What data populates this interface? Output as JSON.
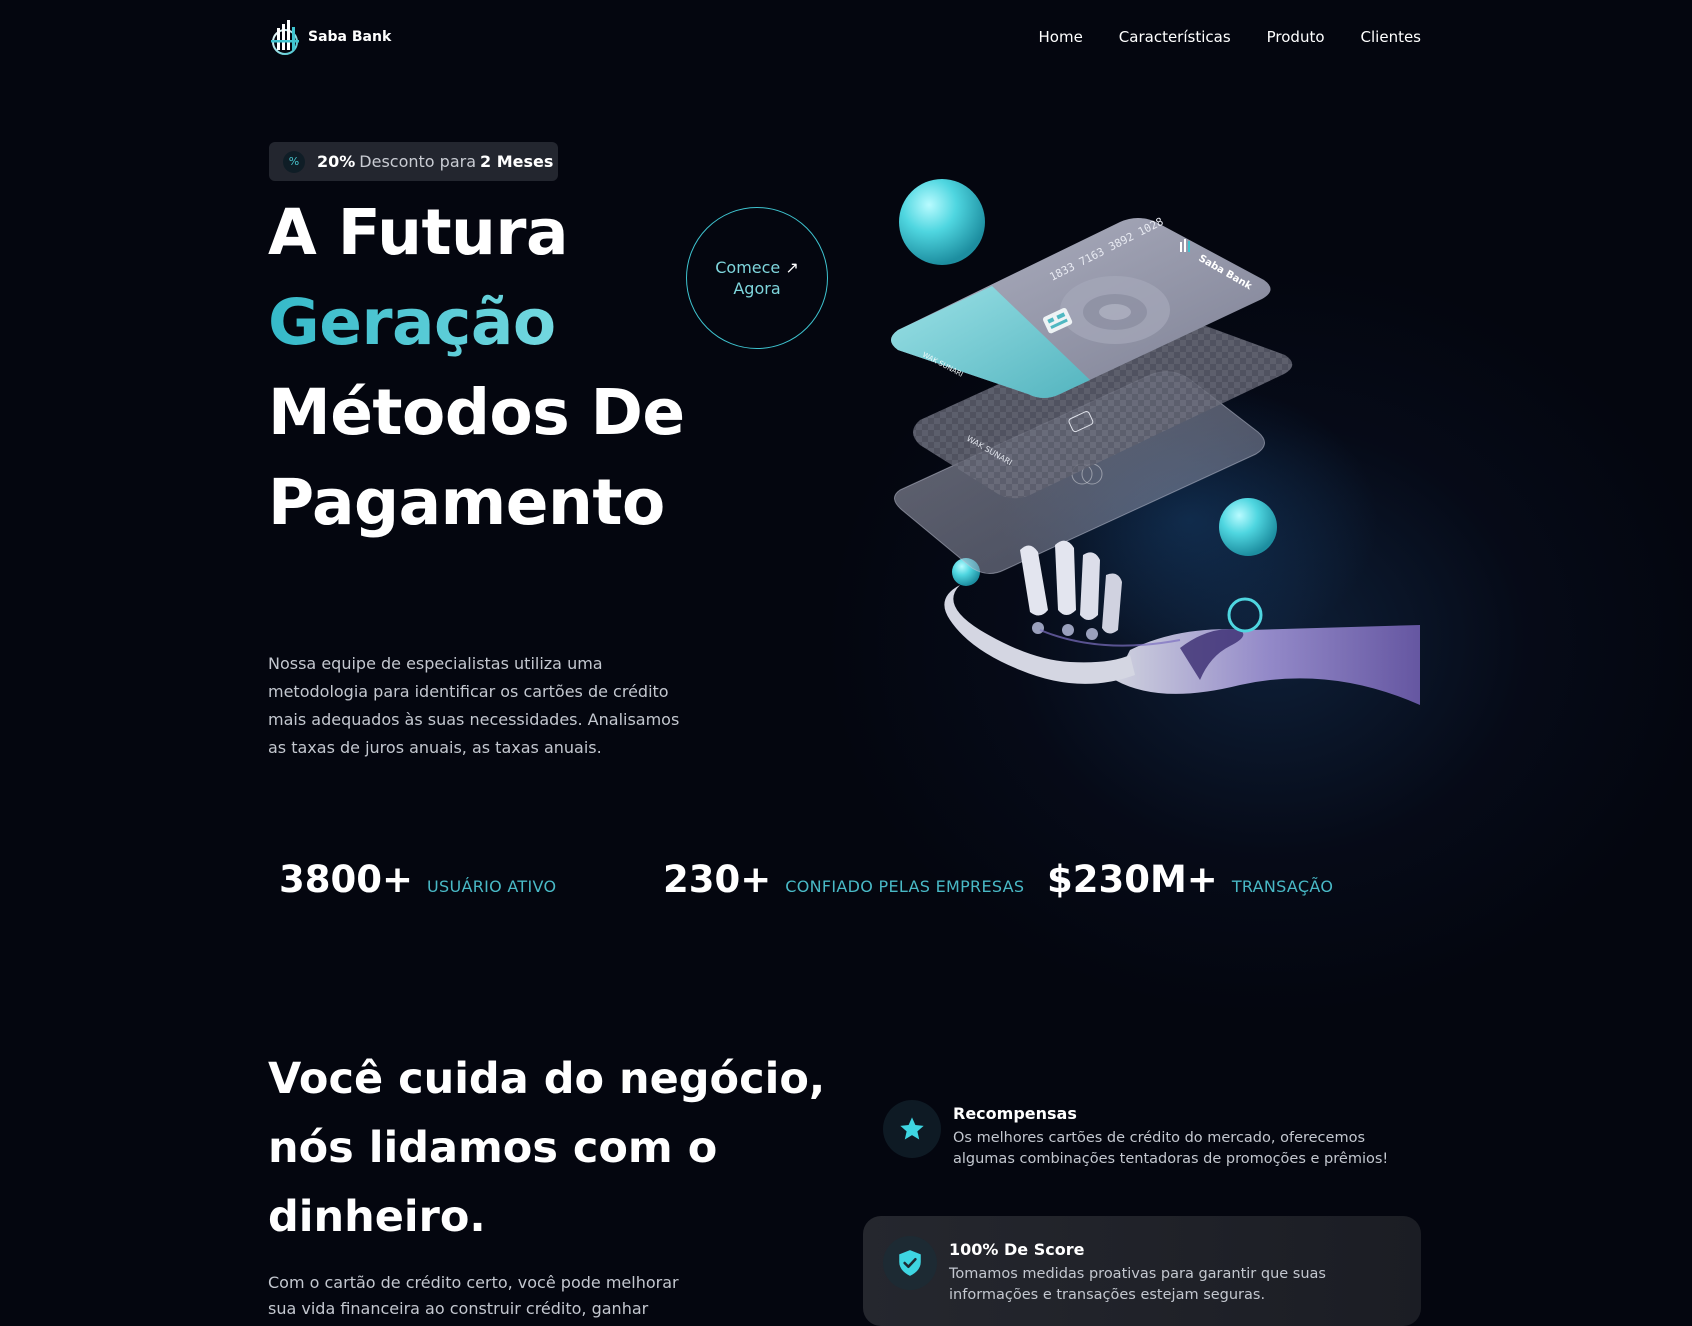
{
  "brand": {
    "name": "Saba Bank",
    "icon": "bank-columns-icon"
  },
  "nav": {
    "items": [
      "Home",
      "Características",
      "Produto",
      "Clientes"
    ]
  },
  "promo": {
    "icon": "percent-icon",
    "pct": "20%",
    "mid": "Desconto para",
    "end": "2 Meses"
  },
  "hero": {
    "title_line1": "A Futura",
    "title_line2": "Geração",
    "title_line3": "Métodos De",
    "title_line4": "Pagamento",
    "cta_line1": "Comece",
    "cta_arrow": "↗",
    "cta_line2": "Agora",
    "description": "Nossa equipe de especialistas utiliza uma metodologia para identificar os cartões de crédito mais adequados às suas necessidades. Analisamos as taxas de juros anuais, as taxas anuais."
  },
  "cards": {
    "number": "1833 7163 3892 1028",
    "brand": "Saba Bank",
    "holder": "WAK SUNARI"
  },
  "stats": [
    {
      "value": "3800+",
      "label": "USUÁRIO ATIVO"
    },
    {
      "value": "230+",
      "label": "CONFIADO PELAS EMPRESAS"
    },
    {
      "value": "$230M+",
      "label": "TRANSAÇÃO"
    }
  ],
  "section2": {
    "title_line1": "Você cuida do negócio,",
    "title_line2": "nós lidamos com o",
    "title_line3": "dinheiro.",
    "description": "Com o cartão de crédito certo, você pode melhorar sua vida financeira ao construir crédito, ganhar",
    "features": [
      {
        "icon": "star-icon",
        "title": "Recompensas",
        "text": "Os melhores cartões de crédito do mercado, oferecemos algumas combinações tentadoras de promoções e prêmios!"
      },
      {
        "icon": "shield-check-icon",
        "title": "100% De Score",
        "text": "Tomamos medidas proativas para garantir que suas informações e transações estejam seguras."
      }
    ]
  },
  "colors": {
    "accent": "#3ec3cf",
    "background": "#04060f",
    "stat_label": "#49b9c6"
  }
}
